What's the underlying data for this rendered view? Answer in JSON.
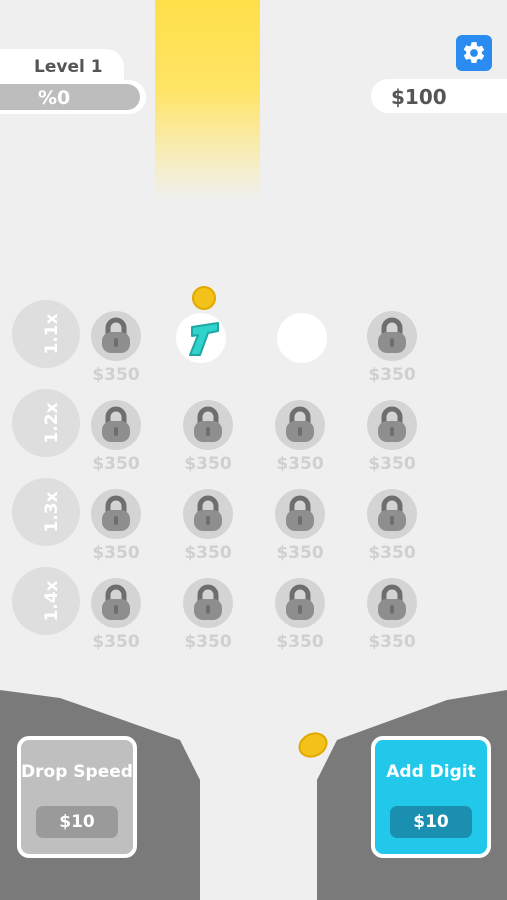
{
  "level": {
    "label": "Level 1",
    "progress": "%0"
  },
  "money": "$100",
  "icons": {
    "settings": "gear-icon",
    "lock": "lock-icon",
    "coin": "coin-icon",
    "digit": "digit-1-icon"
  },
  "colors": {
    "settings_button": "#2a8cf0",
    "add_digit": "#22c8ea",
    "digit": "#2fd2cc",
    "coin": "#f2c21a"
  },
  "multipliers": [
    "1.1x",
    "1.2x",
    "1.3x",
    "1.4x"
  ],
  "grid": [
    [
      {
        "state": "locked",
        "price": "$350"
      },
      {
        "state": "digit"
      },
      {
        "state": "empty"
      },
      {
        "state": "locked",
        "price": "$350"
      }
    ],
    [
      {
        "state": "locked",
        "price": "$350"
      },
      {
        "state": "locked",
        "price": "$350"
      },
      {
        "state": "locked",
        "price": "$350"
      },
      {
        "state": "locked",
        "price": "$350"
      }
    ],
    [
      {
        "state": "locked",
        "price": "$350"
      },
      {
        "state": "locked",
        "price": "$350"
      },
      {
        "state": "locked",
        "price": "$350"
      },
      {
        "state": "locked",
        "price": "$350"
      }
    ],
    [
      {
        "state": "locked",
        "price": "$350"
      },
      {
        "state": "locked",
        "price": "$350"
      },
      {
        "state": "locked",
        "price": "$350"
      },
      {
        "state": "locked",
        "price": "$350"
      }
    ]
  ],
  "drop_speed": {
    "label": "Drop Speed",
    "price": "$10"
  },
  "add_digit": {
    "label": "Add Digit",
    "price": "$10"
  }
}
